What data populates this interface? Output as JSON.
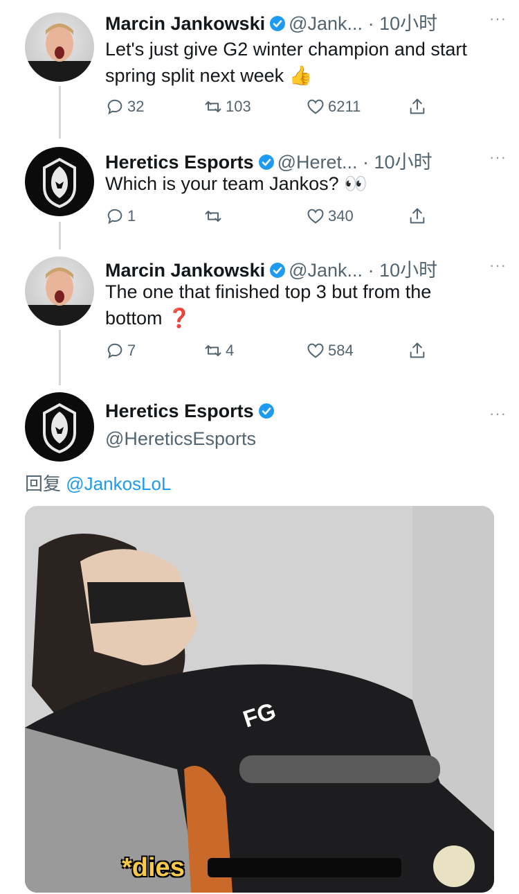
{
  "tweets": [
    {
      "name": "Marcin Jankowski",
      "handle": "@Jank...",
      "time": "· 10小时",
      "text": "Let's just give G2 winter champion and start spring split next week 👍",
      "replies": "32",
      "retweets": "103",
      "likes": "6211"
    },
    {
      "name": "Heretics Esports",
      "handle": "@Heret...",
      "time": "· 10小时",
      "text": "Which is your team Jankos? 👀",
      "replies": "1",
      "retweets": "",
      "likes": "340"
    },
    {
      "name": "Marcin Jankowski",
      "handle": "@Jank...",
      "time": "· 10小时",
      "text": "The one that finished top 3 but from the bottom ❓",
      "replies": "7",
      "retweets": "4",
      "likes": "584"
    }
  ],
  "main_tweet": {
    "name": "Heretics Esports",
    "handle": "@HereticsEsports",
    "reply_prefix": "回复",
    "reply_to": "@JankosLoL",
    "media_caption": "*dies"
  },
  "more_label": "···",
  "colors": {
    "verified": "#1d9bf0",
    "link": "#1d9bf0",
    "muted": "#536471",
    "caption": "#f6c94b"
  }
}
